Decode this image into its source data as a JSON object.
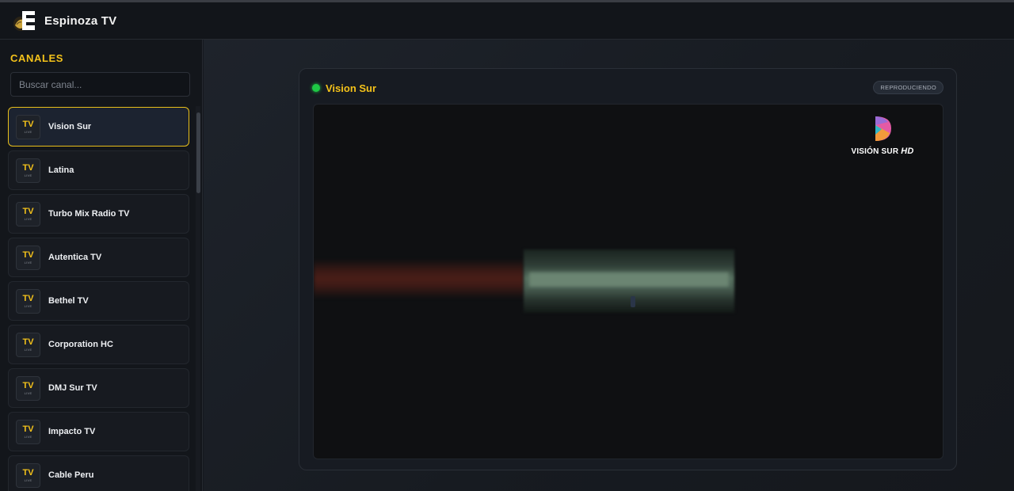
{
  "app": {
    "title": "Espinoza TV",
    "logo_icon": "espinoza-logo-icon"
  },
  "sidebar": {
    "title": "CANALES",
    "search": {
      "placeholder": "Buscar canal...",
      "value": ""
    },
    "badge": {
      "tv": "TV",
      "live": "LIVE"
    },
    "channels": [
      {
        "name": "Vision Sur",
        "active": true
      },
      {
        "name": "Latina",
        "active": false
      },
      {
        "name": "Turbo Mix Radio TV",
        "active": false
      },
      {
        "name": "Autentica TV",
        "active": false
      },
      {
        "name": "Bethel TV",
        "active": false
      },
      {
        "name": "Corporation HC",
        "active": false
      },
      {
        "name": "DMJ Sur TV",
        "active": false
      },
      {
        "name": "Impacto TV",
        "active": false
      },
      {
        "name": "Cable Peru",
        "active": false
      }
    ]
  },
  "player": {
    "title": "Vision Sur",
    "status": "REPRODUCIENDO",
    "overlay": {
      "brand": "VISIÓN SUR",
      "hd": "HD"
    }
  },
  "colors": {
    "accent": "#f4c21a",
    "live": "#1ec845",
    "background": "#15181e"
  }
}
